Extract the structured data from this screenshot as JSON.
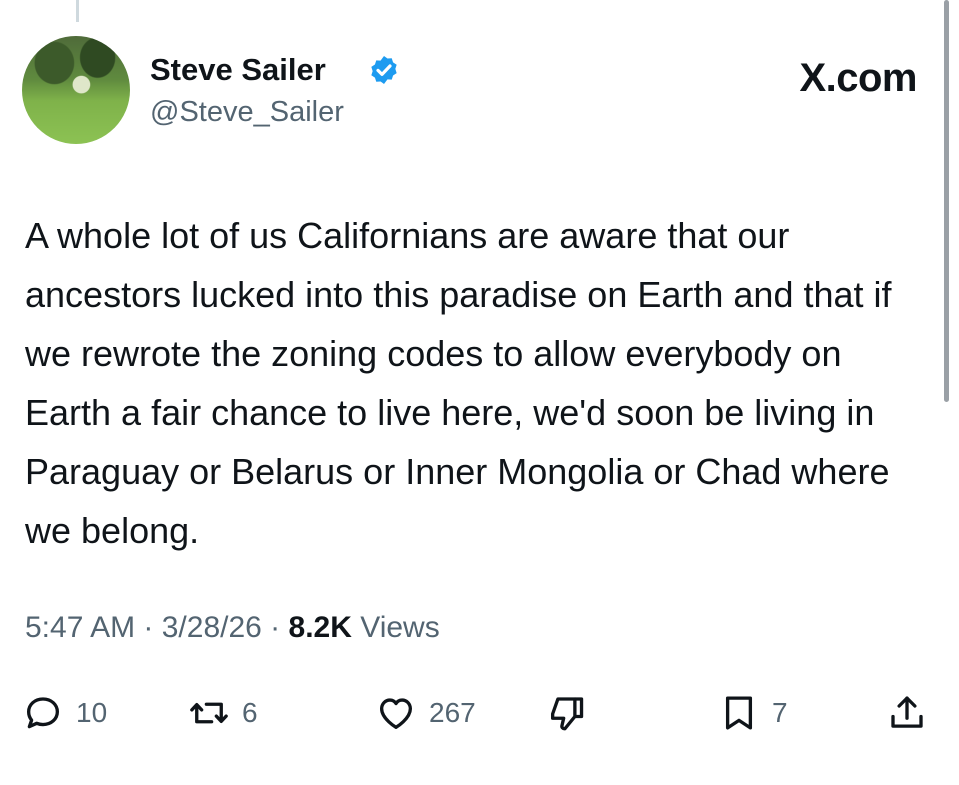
{
  "header": {
    "display_name": "Steve Sailer",
    "handle": "@Steve_Sailer",
    "brand": "X.com"
  },
  "tweet": {
    "text": "A whole lot of us Californians are aware that our ancestors lucked into this paradise on Earth and that if we rewrote the zoning codes to allow everybody on Earth a fair chance to live here, we'd soon be living in Paraguay or Belarus or Inner Mongolia or Chad where we belong."
  },
  "meta": {
    "time": "5:47 AM",
    "separator": " · ",
    "date": "3/28/26",
    "views_count": "8.2K",
    "views_label": " Views"
  },
  "actions": {
    "reply": {
      "icon": "reply-icon",
      "count": "10"
    },
    "repost": {
      "icon": "repost-icon",
      "count": "6"
    },
    "like": {
      "icon": "heart-icon",
      "count": "267"
    },
    "dislike": {
      "icon": "thumbs-down-icon"
    },
    "bookmark": {
      "icon": "bookmark-icon",
      "count": "7"
    },
    "share": {
      "icon": "share-icon"
    }
  },
  "colors": {
    "text": "#0f1419",
    "secondary": "#536471",
    "verified": "#1d9bf0",
    "background": "#ffffff"
  }
}
